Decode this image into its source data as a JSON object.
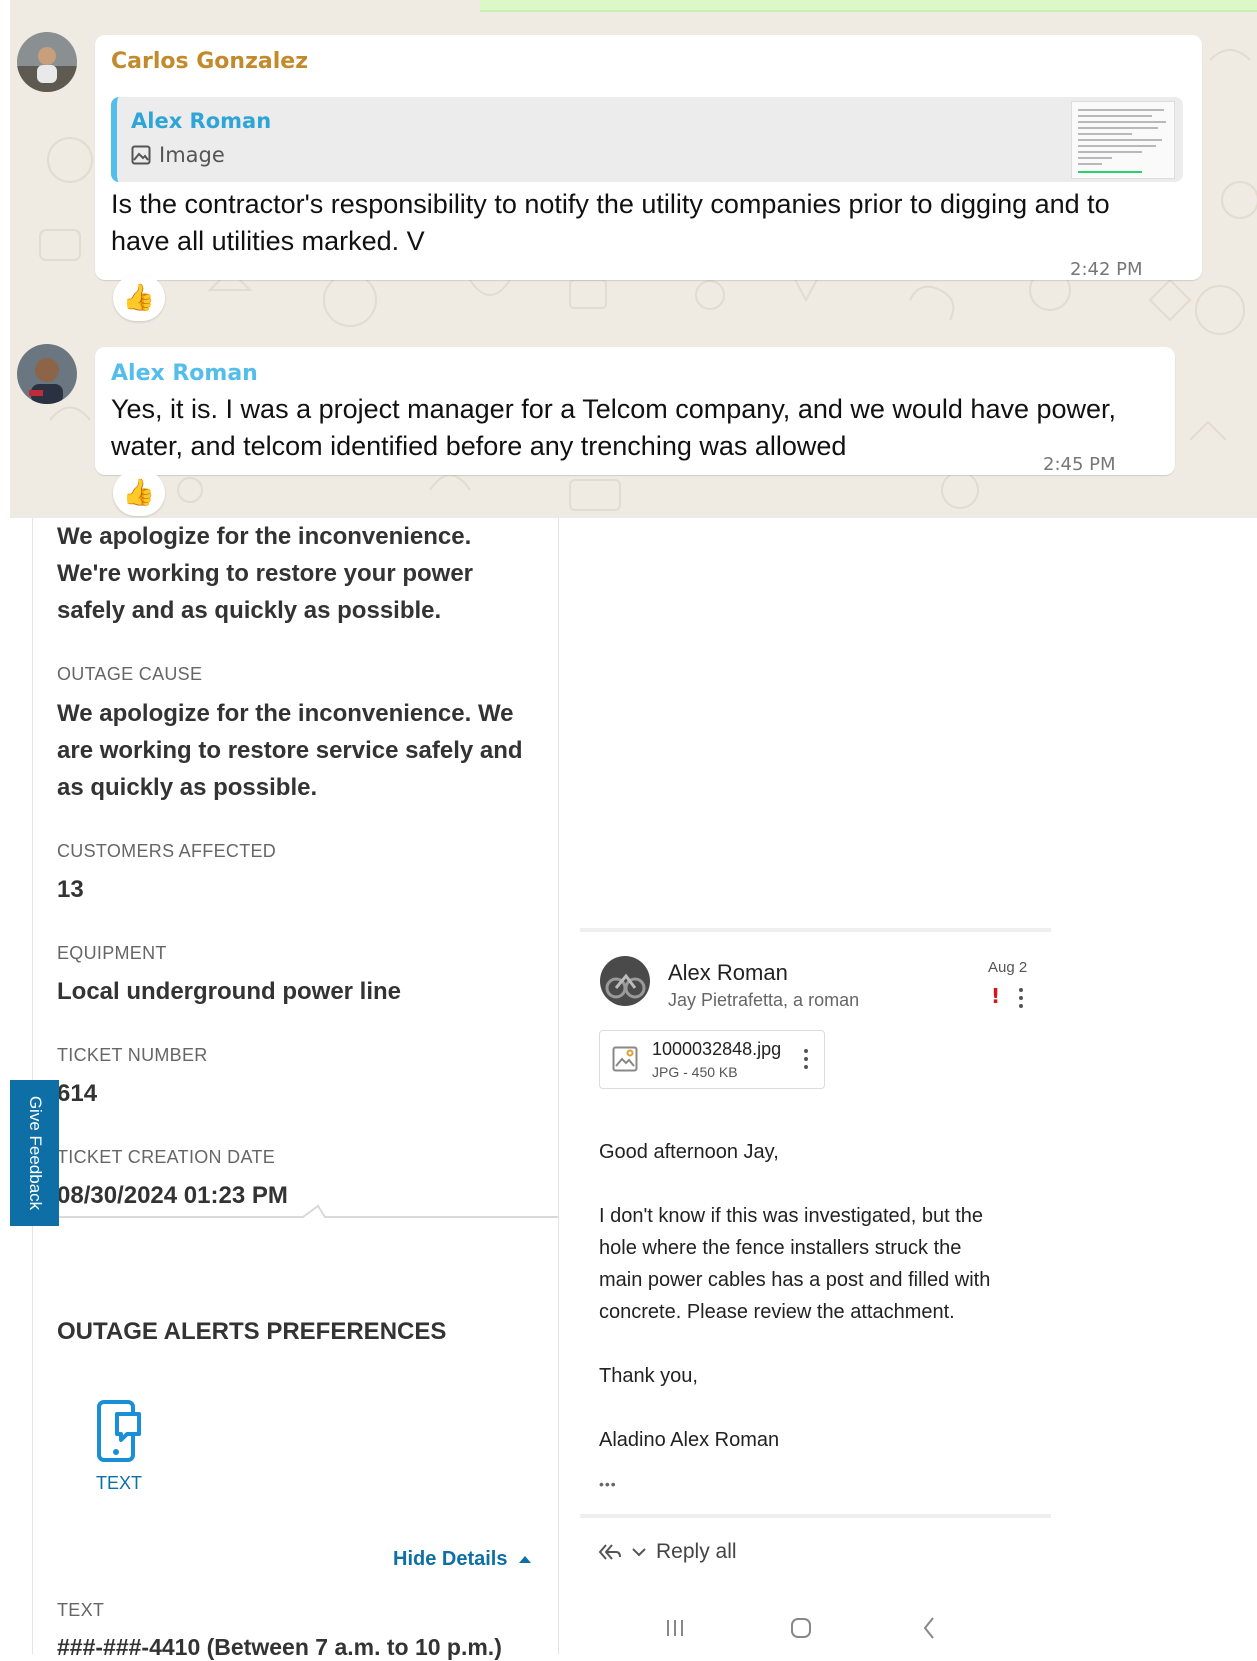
{
  "chat": {
    "messages": [
      {
        "sender": "Carlos Gonzalez",
        "sender_color": "#c38a2b",
        "quote": {
          "author": "Alex Roman",
          "type": "Image"
        },
        "text": "Is the contractor's responsibility to notify the utility companies prior to digging and to have all utilities marked. V",
        "time": "2:42 PM",
        "reaction": "👍"
      },
      {
        "sender": "Alex Roman",
        "sender_color": "#53bdeb",
        "text": "Yes, it is. I was a project manager for a Telcom company, and we would have power, water, and telcom identified before any trenching was allowed",
        "time": "2:45 PM",
        "reaction": "👍"
      }
    ]
  },
  "outage": {
    "intro_text": "We apologize for the inconvenience. We're working to restore your power safely and as quickly as possible.",
    "cause_label": "OUTAGE CAUSE",
    "cause_value": "We apologize for the inconvenience. We are working to restore service safely and as quickly as possible.",
    "customers_label": "CUSTOMERS AFFECTED",
    "customers_value": "13",
    "equipment_label": "EQUIPMENT",
    "equipment_value": "Local underground power line",
    "ticket_label": "TICKET NUMBER",
    "ticket_value": "614",
    "date_label": "TICKET CREATION DATE",
    "date_value": "08/30/2024 01:23 PM",
    "preferences_title": "OUTAGE ALERTS PREFERENCES",
    "text_option_label": "TEXT",
    "hide_details": "Hide Details",
    "text_detail_label": "TEXT",
    "text_detail_value": "###-###-4410 (Between 7 a.m. to 10 p.m.)",
    "feedback_tab": "Give Feedback",
    "accent_color": "#0d6fa6"
  },
  "email": {
    "from": "Alex Roman",
    "to": "Jay Pietrafetta, a roman",
    "date": "Aug 2",
    "important_icon": "exclamation-icon",
    "attachment": {
      "name": "1000032848.jpg",
      "meta": "JPG - 450 KB"
    },
    "greeting": "Good afternoon Jay,",
    "body_lines": [
      "I don't know if this was investigated, but the",
      "hole where the fence installers struck the",
      "main power cables has a post and filled with",
      "concrete. Please review the attachment."
    ],
    "closing": "Thank you,",
    "signature": "Aladino Alex Roman",
    "ellipsis": "•••",
    "reply_all": "Reply all"
  }
}
